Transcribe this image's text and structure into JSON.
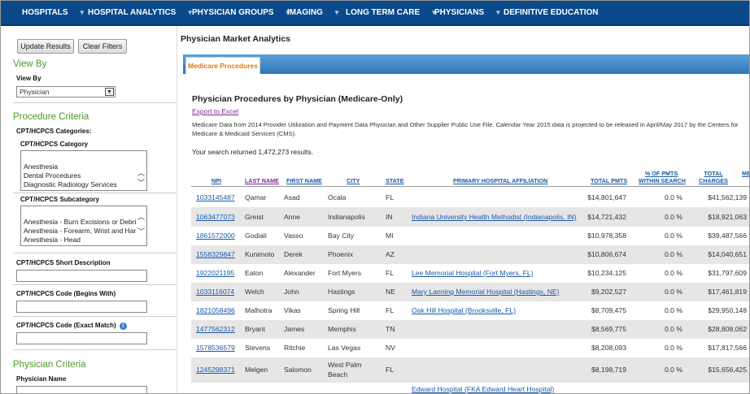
{
  "nav": {
    "items": [
      {
        "label": "HOSPITALS",
        "caret": true
      },
      {
        "label": "HOSPITAL ANALYTICS",
        "caret": true
      },
      {
        "label": "PHYSICIAN GROUPS",
        "caret": true
      },
      {
        "label": "IMAGING",
        "caret": true
      },
      {
        "label": "LONG TERM CARE",
        "caret": true
      },
      {
        "label": "PHYSICIANS",
        "caret": true
      },
      {
        "label": "DEFINITIVE EDUCATION",
        "caret": false
      }
    ],
    "caret_glyph": "▾"
  },
  "sidebar": {
    "update_btn": "Update Results",
    "clear_btn": "Clear Filters",
    "view_by_heading": "View By",
    "view_by_label": "View By",
    "view_by_value": "Physician",
    "procedure_heading": "Procedure Criteria",
    "categories_label": "CPT/HCPCS Categories:",
    "category_label": "CPT/HCPCS Category",
    "category_options": [
      "Anesthesia",
      "Dental Procedures",
      "Diagnostic Radiology Services"
    ],
    "subcategory_label": "CPT/HCPCS Subcategory",
    "subcategory_options": [
      "Anesthesia - Burn Excisions or Debridement",
      "Anesthesia - Forearm, Wrist and Hand",
      "Anesthesia - Head"
    ],
    "short_desc_label": "CPT/HCPCS Short Description",
    "code_begins_label": "CPT/HCPCS Code (Begins With)",
    "code_exact_label": "CPT/HCPCS Code (Exact Match)",
    "info_glyph": "i",
    "physician_heading": "Physician Criteria",
    "physician_name_label": "Physician Name"
  },
  "main": {
    "page_title": "Physician Market Analytics",
    "tab_label": "Medicare Procedures",
    "section_title": "Physician Procedures by Physician (Medicare-Only)",
    "export_label": "Export to Excel",
    "description": "Medicare Data from 2014 Provider Utilization and Payment Data Physician and Other Supplier Public Use File. Calendar Year 2015 data is projected to be released in April/May 2017 by the Centers for Medicare & Medicaid Services (CMS).",
    "results_text": "Your search returned 1,472,273 results."
  },
  "table": {
    "headers": {
      "npi": "NPI",
      "last_name": "LAST NAME",
      "first_name": "FIRST NAME",
      "city": "CITY",
      "state": "STATE",
      "hospital": "PRIMARY HOSPITAL AFFILIATION",
      "total_pmts": "TOTAL PMTS",
      "pct_line1": "% OF PMTS",
      "pct_line2": "WITHIN SEARCH",
      "charges_line1": "TOTAL",
      "charges_line2": "CHARGES",
      "more": "ME"
    },
    "rows": [
      {
        "npi": "1033145487",
        "last": "Qamar",
        "first": "Asad",
        "city": "Ocala",
        "state": "FL",
        "hospital": "",
        "pmts": "$14,801,647",
        "pct": "0.0 %",
        "charges": "$41,562,139"
      },
      {
        "npi": "1063477073",
        "last": "Greist",
        "first": "Anne",
        "city": "Indianapolis",
        "state": "IN",
        "hospital": "Indiana University Health Methodist (Indianapolis, IN)",
        "pmts": "$14,721,432",
        "pct": "0.0 %",
        "charges": "$18,921,063"
      },
      {
        "npi": "1861572000",
        "last": "Godiali",
        "first": "Vasso",
        "city": "Bay City",
        "state": "MI",
        "hospital": "",
        "pmts": "$10,978,358",
        "pct": "0.0 %",
        "charges": "$39,487,566"
      },
      {
        "npi": "1558329847",
        "last": "Kunimoto",
        "first": "Derek",
        "city": "Phoenix",
        "state": "AZ",
        "hospital": "",
        "pmts": "$10,806,674",
        "pct": "0.0 %",
        "charges": "$14,040,651"
      },
      {
        "npi": "1922021195",
        "last": "Eaton",
        "first": "Alexander",
        "city": "Fort Myers",
        "state": "FL",
        "hospital": "Lee Memorial Hospital (Fort Myers, FL)",
        "pmts": "$10,234,125",
        "pct": "0.0 %",
        "charges": "$31,797,609"
      },
      {
        "npi": "1033116074",
        "last": "Welch",
        "first": "John",
        "city": "Hastings",
        "state": "NE",
        "hospital": "Mary Lanning Memorial Hospital (Hastings, NE)",
        "pmts": "$9,202,527",
        "pct": "0.0 %",
        "charges": "$17,461,819"
      },
      {
        "npi": "1821058496",
        "last": "Malhotra",
        "first": "Vikas",
        "city": "Spring Hill",
        "state": "FL",
        "hospital": "Oak Hill Hospital (Brooksville, FL)",
        "pmts": "$8,709,475",
        "pct": "0.0 %",
        "charges": "$29,950,148"
      },
      {
        "npi": "1477562312",
        "last": "Bryant",
        "first": "James",
        "city": "Memphis",
        "state": "TN",
        "hospital": "",
        "pmts": "$8,569,775",
        "pct": "0.0 %",
        "charges": "$28,808,062"
      },
      {
        "npi": "1578536579",
        "last": "Stevens",
        "first": "Ritchie",
        "city": "Las Vegas",
        "state": "NV",
        "hospital": "",
        "pmts": "$8,208,093",
        "pct": "0.0 %",
        "charges": "$17,817,566"
      },
      {
        "npi": "1245298371",
        "last": "Melgen",
        "first": "Salomon",
        "city_line1": "West Palm",
        "city_line2": "Beach",
        "state": "FL",
        "hospital": "",
        "pmts": "$8,198,719",
        "pct": "0.0 %",
        "charges": "$15,656,425"
      }
    ],
    "partial_row_hospital": "Edward Hospital (FKA Edward Heart Hospital)"
  }
}
